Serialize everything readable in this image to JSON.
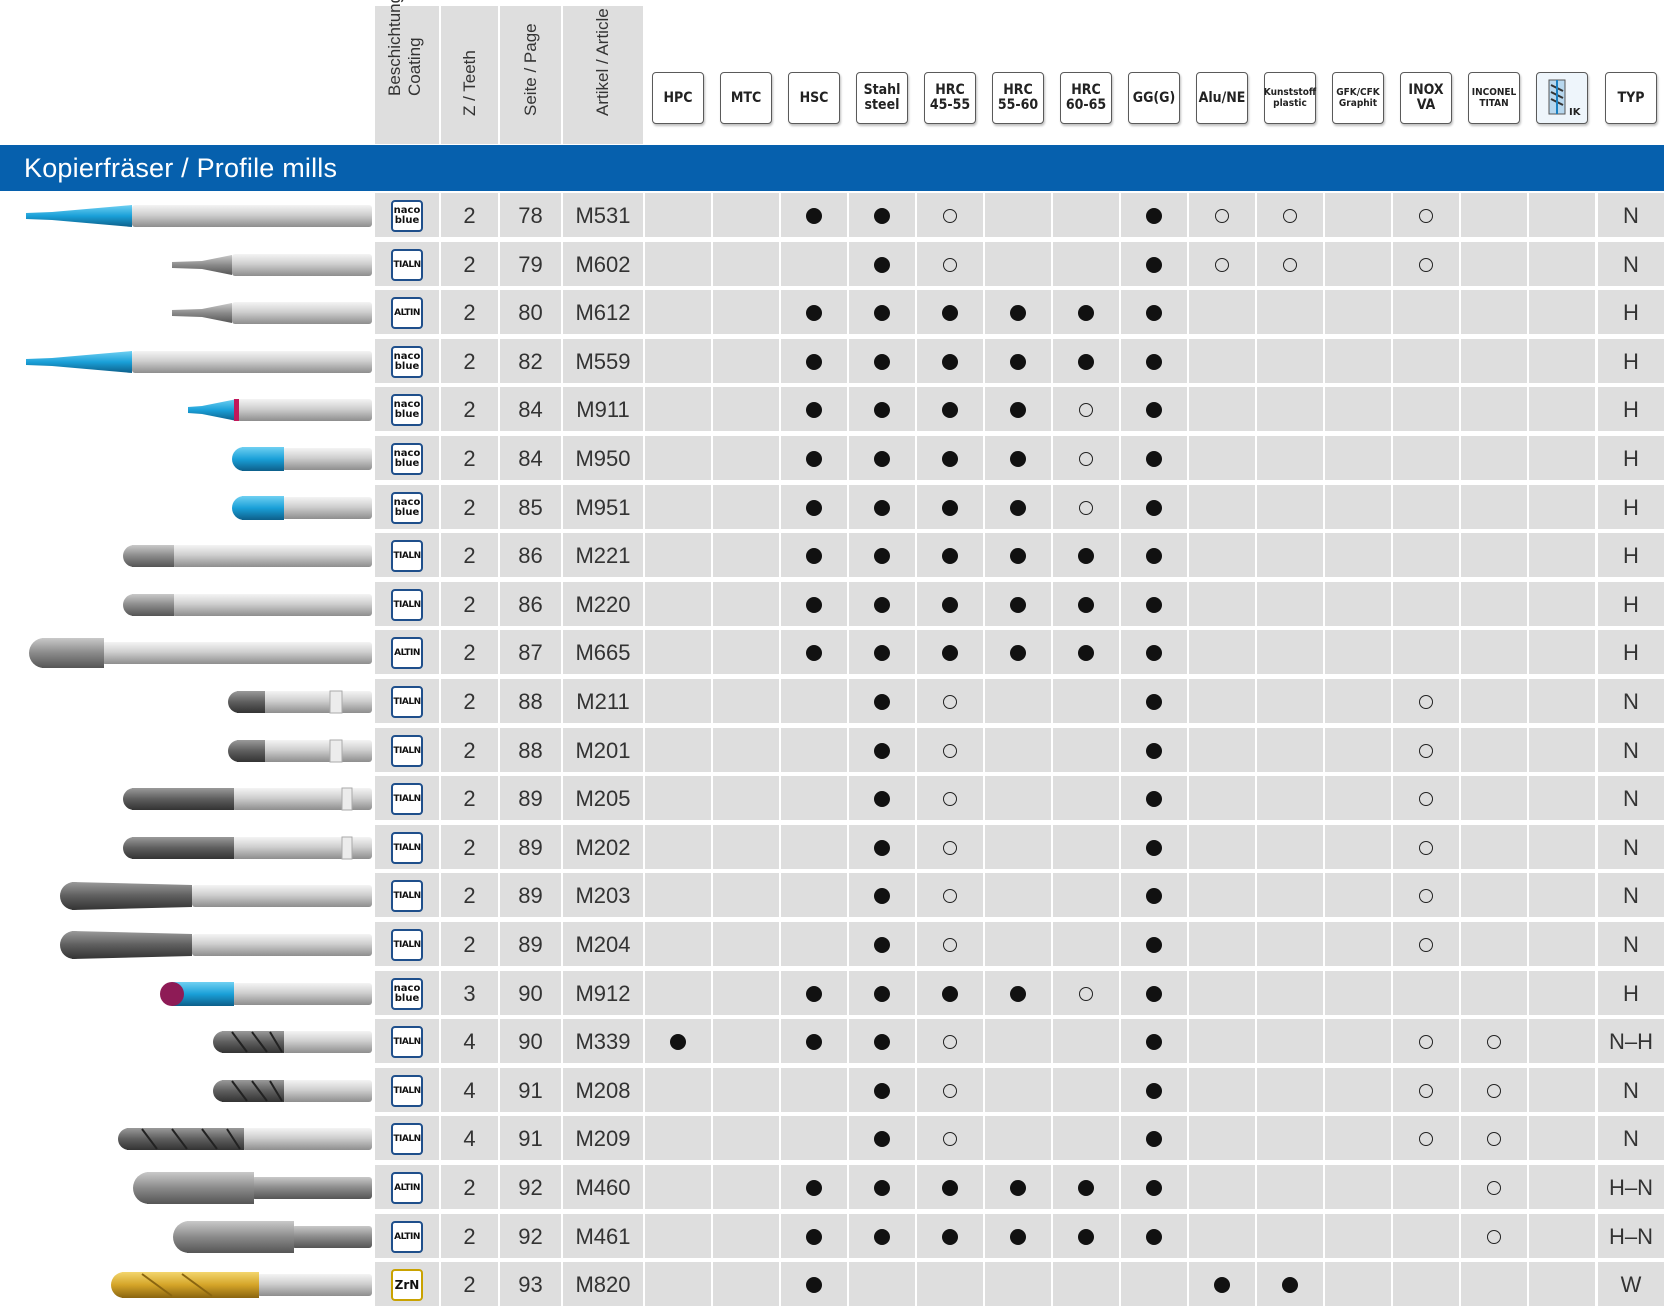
{
  "header": {
    "coating_label": "Beschichtung\nCoating",
    "teeth_label": "Z / Teeth",
    "page_label": "Seite / Page",
    "article_label": "Artikel / Article",
    "materials": [
      "HPC",
      "MTC",
      "HSC",
      "Stahl\nsteel",
      "HRC\n45-55",
      "HRC\n55-60",
      "HRC\n60-65",
      "GG(G)",
      "Alu/NE",
      "Kunststoff\nplastic",
      "GFK/CFK\nGraphit",
      "INOX\nVA",
      "INCONEL\nTITAN",
      "IK",
      "TYP"
    ]
  },
  "section_title": "Kopierfräser / Profile mills",
  "legend": {
    "full": "full-circle",
    "open": "open-circle"
  },
  "colors": {
    "banner": "#0660ad",
    "shaded": "#dedede",
    "tool_blue": "#1aa0d8"
  },
  "rows": [
    {
      "tool": "tool-blue-long",
      "coating": "naco\nblue",
      "teeth": "2",
      "page": "78",
      "article": "M531",
      "marks": [
        "",
        "",
        "F",
        "F",
        "O",
        "",
        "",
        "F",
        "O",
        "O",
        "",
        "O",
        "",
        ""
      ],
      "typ": "N"
    },
    {
      "tool": "tool-silver-thin",
      "coating": "TIALN",
      "teeth": "2",
      "page": "79",
      "article": "M602",
      "marks": [
        "",
        "",
        "",
        "F",
        "O",
        "",
        "",
        "F",
        "O",
        "O",
        "",
        "O",
        "",
        ""
      ],
      "typ": "N"
    },
    {
      "tool": "tool-silver-thin",
      "coating": "ALTIN",
      "teeth": "2",
      "page": "80",
      "article": "M612",
      "marks": [
        "",
        "",
        "F",
        "F",
        "F",
        "F",
        "F",
        "F",
        "",
        "",
        "",
        "",
        "",
        ""
      ],
      "typ": "H"
    },
    {
      "tool": "tool-blue-long",
      "coating": "naco\nblue",
      "teeth": "2",
      "page": "82",
      "article": "M559",
      "marks": [
        "",
        "",
        "F",
        "F",
        "F",
        "F",
        "F",
        "F",
        "",
        "",
        "",
        "",
        "",
        ""
      ],
      "typ": "H"
    },
    {
      "tool": "tool-blue-short",
      "coating": "naco\nblue",
      "teeth": "2",
      "page": "84",
      "article": "M911",
      "marks": [
        "",
        "",
        "F",
        "F",
        "F",
        "F",
        "O",
        "F",
        "",
        "",
        "",
        "",
        "",
        ""
      ],
      "typ": "H"
    },
    {
      "tool": "tool-blue-ball",
      "coating": "naco\nblue",
      "teeth": "2",
      "page": "84",
      "article": "M950",
      "marks": [
        "",
        "",
        "F",
        "F",
        "F",
        "F",
        "O",
        "F",
        "",
        "",
        "",
        "",
        "",
        ""
      ],
      "typ": "H"
    },
    {
      "tool": "tool-blue-ball",
      "coating": "naco\nblue",
      "teeth": "2",
      "page": "85",
      "article": "M951",
      "marks": [
        "",
        "",
        "F",
        "F",
        "F",
        "F",
        "O",
        "F",
        "",
        "",
        "",
        "",
        "",
        ""
      ],
      "typ": "H"
    },
    {
      "tool": "tool-silver-ball",
      "coating": "TIALN",
      "teeth": "2",
      "page": "86",
      "article": "M221",
      "marks": [
        "",
        "",
        "F",
        "F",
        "F",
        "F",
        "F",
        "F",
        "",
        "",
        "",
        "",
        "",
        ""
      ],
      "typ": "H"
    },
    {
      "tool": "tool-silver-ball",
      "coating": "TIALN",
      "teeth": "2",
      "page": "86",
      "article": "M220",
      "marks": [
        "",
        "",
        "F",
        "F",
        "F",
        "F",
        "F",
        "F",
        "",
        "",
        "",
        "",
        "",
        ""
      ],
      "typ": "H"
    },
    {
      "tool": "tool-silver-big",
      "coating": "ALTIN",
      "teeth": "2",
      "page": "87",
      "article": "M665",
      "marks": [
        "",
        "",
        "F",
        "F",
        "F",
        "F",
        "F",
        "F",
        "",
        "",
        "",
        "",
        "",
        ""
      ],
      "typ": "H"
    },
    {
      "tool": "tool-dark-short",
      "coating": "TIALN",
      "teeth": "2",
      "page": "88",
      "article": "M211",
      "marks": [
        "",
        "",
        "",
        "F",
        "O",
        "",
        "",
        "F",
        "",
        "",
        "",
        "O",
        "",
        ""
      ],
      "typ": "N"
    },
    {
      "tool": "tool-dark-short",
      "coating": "TIALN",
      "teeth": "2",
      "page": "88",
      "article": "M201",
      "marks": [
        "",
        "",
        "",
        "F",
        "O",
        "",
        "",
        "F",
        "",
        "",
        "",
        "O",
        "",
        ""
      ],
      "typ": "N"
    },
    {
      "tool": "tool-dark-long",
      "coating": "TIALN",
      "teeth": "2",
      "page": "89",
      "article": "M205",
      "marks": [
        "",
        "",
        "",
        "F",
        "O",
        "",
        "",
        "F",
        "",
        "",
        "",
        "O",
        "",
        ""
      ],
      "typ": "N"
    },
    {
      "tool": "tool-dark-long",
      "coating": "TIALN",
      "teeth": "2",
      "page": "89",
      "article": "M202",
      "marks": [
        "",
        "",
        "",
        "F",
        "O",
        "",
        "",
        "F",
        "",
        "",
        "",
        "O",
        "",
        ""
      ],
      "typ": "N"
    },
    {
      "tool": "tool-dark-xl",
      "coating": "TIALN",
      "teeth": "2",
      "page": "89",
      "article": "M203",
      "marks": [
        "",
        "",
        "",
        "F",
        "O",
        "",
        "",
        "F",
        "",
        "",
        "",
        "O",
        "",
        ""
      ],
      "typ": "N"
    },
    {
      "tool": "tool-dark-xl",
      "coating": "TIALN",
      "teeth": "2",
      "page": "89",
      "article": "M204",
      "marks": [
        "",
        "",
        "",
        "F",
        "O",
        "",
        "",
        "F",
        "",
        "",
        "",
        "O",
        "",
        ""
      ],
      "typ": "N"
    },
    {
      "tool": "tool-blue-red",
      "coating": "naco\nblue",
      "teeth": "3",
      "page": "90",
      "article": "M912",
      "marks": [
        "",
        "",
        "F",
        "F",
        "F",
        "F",
        "O",
        "F",
        "",
        "",
        "",
        "",
        "",
        ""
      ],
      "typ": "H"
    },
    {
      "tool": "tool-dark-4",
      "coating": "TIALN",
      "teeth": "4",
      "page": "90",
      "article": "M339",
      "marks": [
        "F",
        "",
        "F",
        "F",
        "O",
        "",
        "",
        "F",
        "",
        "",
        "",
        "O",
        "O",
        ""
      ],
      "typ": "N–H"
    },
    {
      "tool": "tool-dark-4",
      "coating": "TIALN",
      "teeth": "4",
      "page": "91",
      "article": "M208",
      "marks": [
        "",
        "",
        "",
        "F",
        "O",
        "",
        "",
        "F",
        "",
        "",
        "",
        "O",
        "O",
        ""
      ],
      "typ": "N"
    },
    {
      "tool": "tool-dark-4long",
      "coating": "TIALN",
      "teeth": "4",
      "page": "91",
      "article": "M209",
      "marks": [
        "",
        "",
        "",
        "F",
        "O",
        "",
        "",
        "F",
        "",
        "",
        "",
        "O",
        "O",
        ""
      ],
      "typ": "N"
    },
    {
      "tool": "tool-grey-thick",
      "coating": "ALTIN",
      "teeth": "2",
      "page": "92",
      "article": "M460",
      "marks": [
        "",
        "",
        "F",
        "F",
        "F",
        "F",
        "F",
        "F",
        "",
        "",
        "",
        "",
        "O",
        ""
      ],
      "typ": "H–N"
    },
    {
      "tool": "tool-grey-thick2",
      "coating": "ALTIN",
      "teeth": "2",
      "page": "92",
      "article": "M461",
      "marks": [
        "",
        "",
        "F",
        "F",
        "F",
        "F",
        "F",
        "F",
        "",
        "",
        "",
        "",
        "O",
        ""
      ],
      "typ": "H–N"
    },
    {
      "tool": "tool-gold",
      "coating": "ZrN",
      "teeth": "2",
      "page": "93",
      "article": "M820",
      "marks": [
        "",
        "",
        "F",
        "",
        "",
        "",
        "",
        "",
        "F",
        "F",
        "",
        "",
        "",
        ""
      ],
      "typ": "W"
    }
  ]
}
